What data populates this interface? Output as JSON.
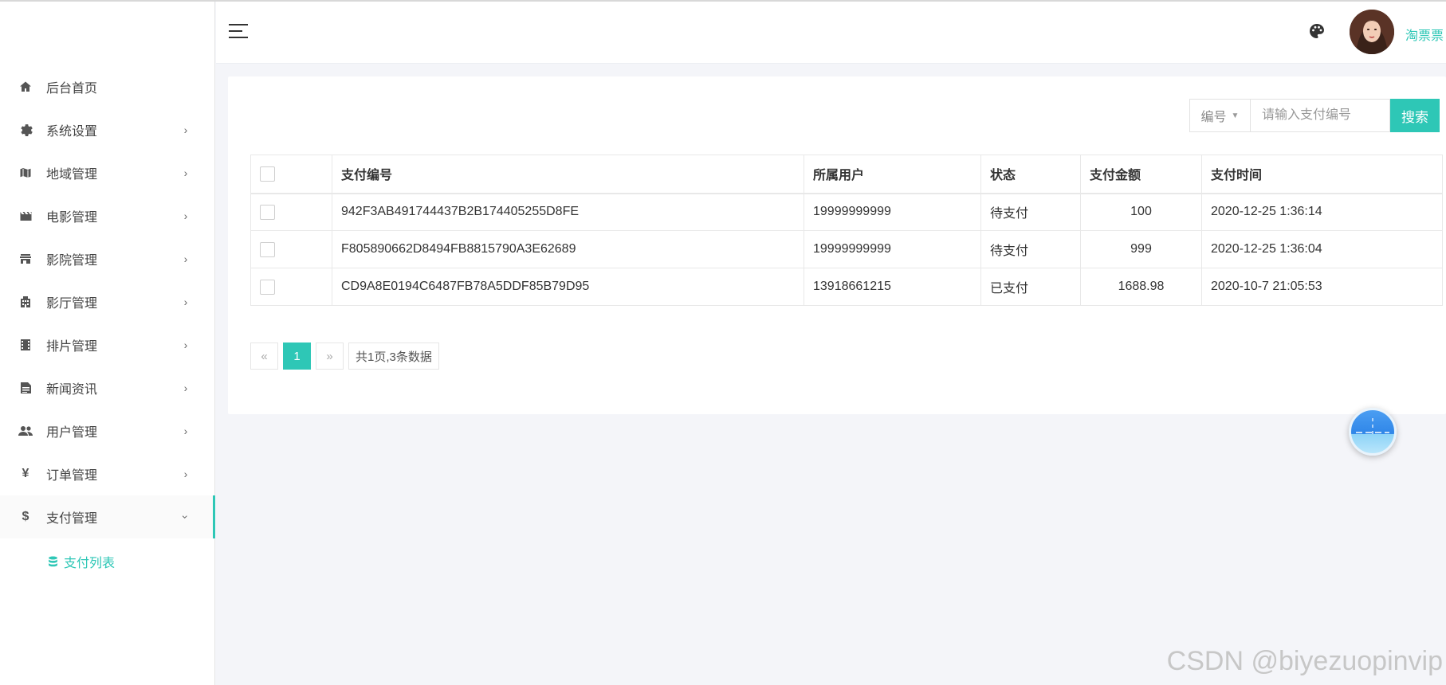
{
  "sidebar": {
    "items": [
      {
        "label": "后台首页",
        "icon": "home-icon",
        "has_arrow": false
      },
      {
        "label": "系统设置",
        "icon": "gear-icon",
        "has_arrow": true
      },
      {
        "label": "地域管理",
        "icon": "map-icon",
        "has_arrow": true
      },
      {
        "label": "电影管理",
        "icon": "movie-icon",
        "has_arrow": true
      },
      {
        "label": "影院管理",
        "icon": "store-icon",
        "has_arrow": true
      },
      {
        "label": "影厅管理",
        "icon": "building-icon",
        "has_arrow": true
      },
      {
        "label": "排片管理",
        "icon": "film-strip-icon",
        "has_arrow": true
      },
      {
        "label": "新闻资讯",
        "icon": "article-icon",
        "has_arrow": true
      },
      {
        "label": "用户管理",
        "icon": "users-icon",
        "has_arrow": true
      },
      {
        "label": "订单管理",
        "icon": "yen-icon",
        "has_arrow": true
      },
      {
        "label": "支付管理",
        "icon": "dollar-icon",
        "has_arrow": true,
        "expanded": true
      }
    ],
    "submenu": {
      "label": "支付列表",
      "icon": "database-icon"
    },
    "accent": "#2ec7b6"
  },
  "header": {
    "username": "淘票票"
  },
  "search": {
    "select_label": "编号",
    "placeholder": "请输入支付编号",
    "button_label": "搜索"
  },
  "table": {
    "headers": [
      "支付编号",
      "所属用户",
      "状态",
      "支付金额",
      "支付时间"
    ],
    "rows": [
      {
        "id": "942F3AB491744437B2B174405255D8FE",
        "user": "19999999999",
        "status": "待支付",
        "amount": "100",
        "time": "2020-12-25 1:36:14"
      },
      {
        "id": "F805890662D8494FB8815790A3E62689",
        "user": "19999999999",
        "status": "待支付",
        "amount": "999",
        "time": "2020-12-25 1:36:04"
      },
      {
        "id": "CD9A8E0194C6487FB78A5DDF85B79D95",
        "user": "13918661215",
        "status": "已支付",
        "amount": "1688.98",
        "time": "2020-10-7 21:05:53"
      }
    ]
  },
  "pagination": {
    "prev": "«",
    "current": "1",
    "next": "»",
    "info": "共1页,3条数据"
  },
  "watermark": "CSDN @biyezuopinvip",
  "colors": {
    "pending": "#f0a23a",
    "paid": "#1fb872"
  }
}
